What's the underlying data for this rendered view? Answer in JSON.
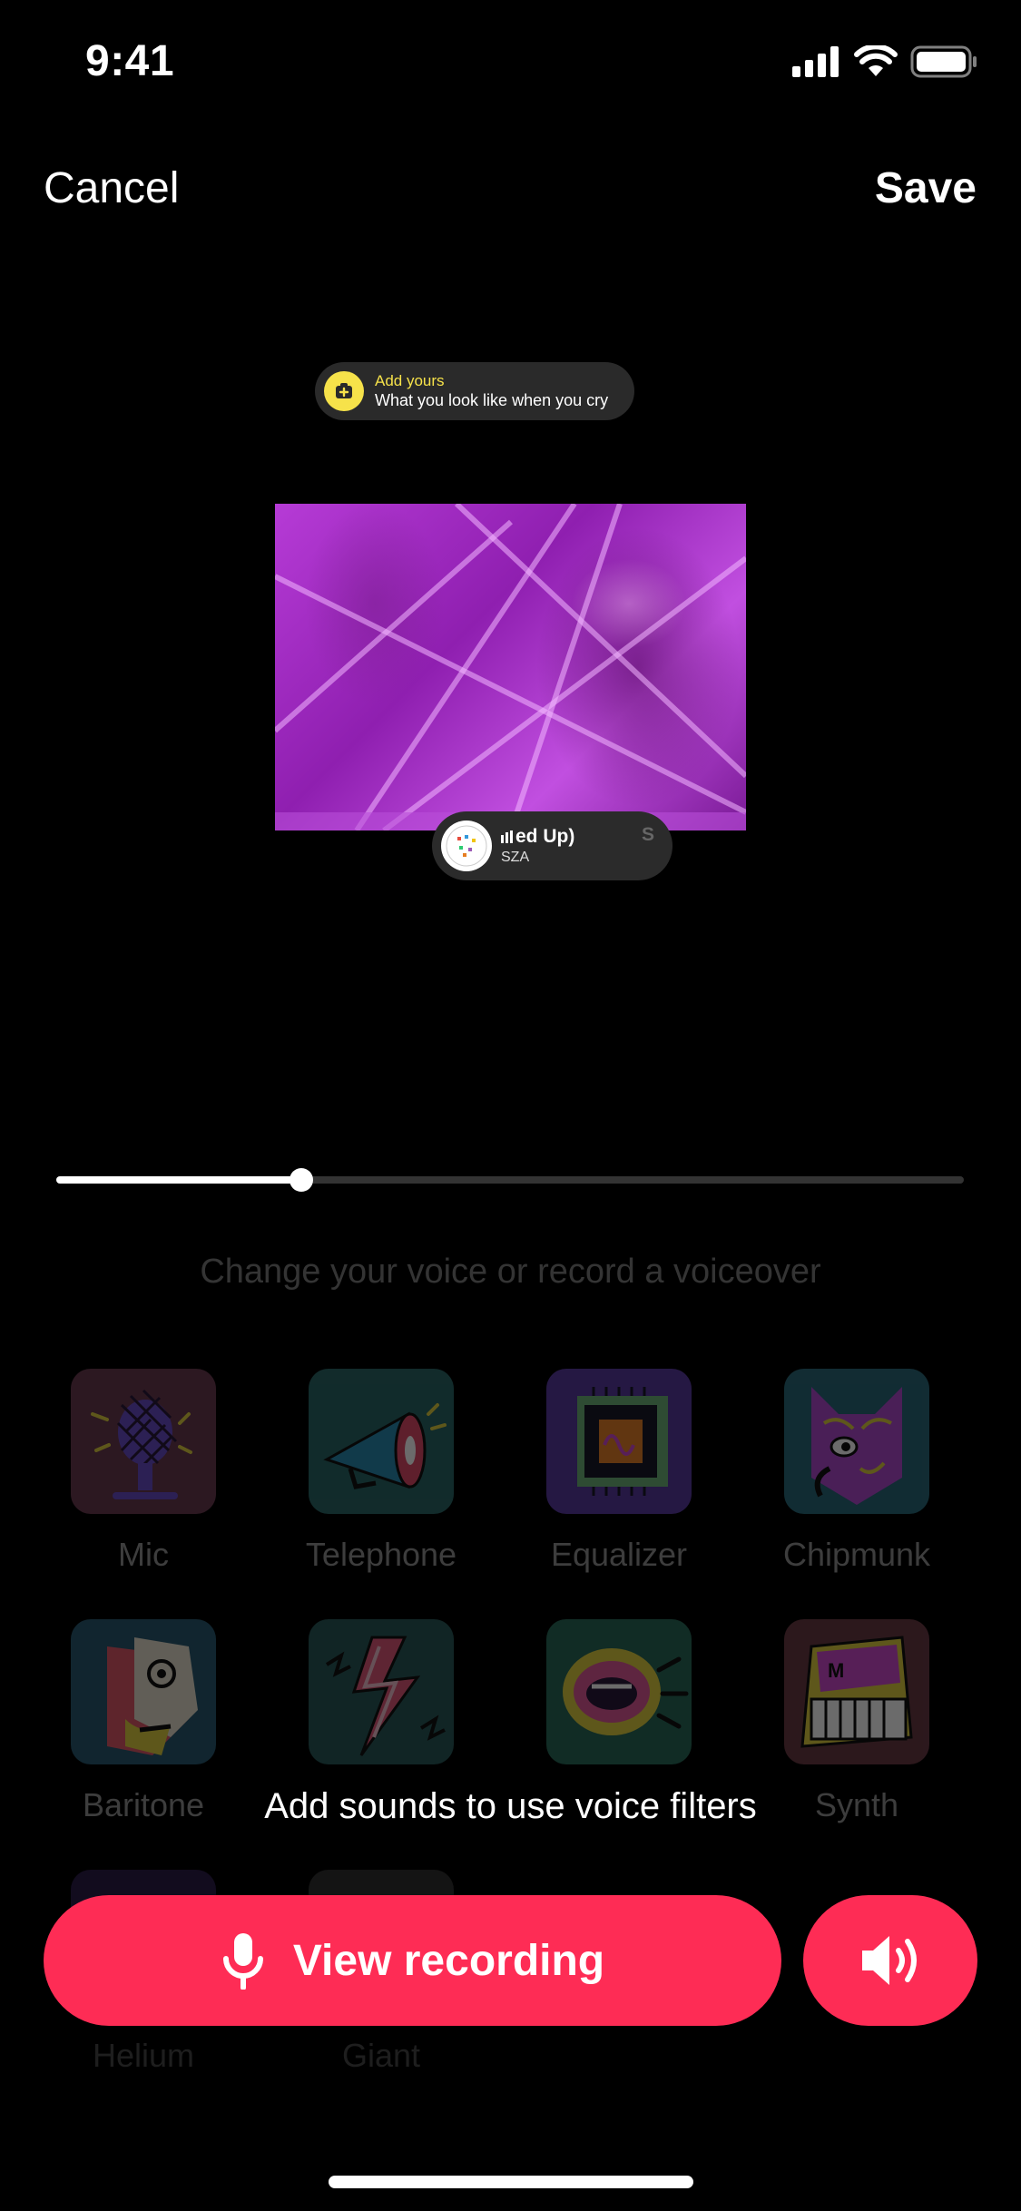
{
  "status_bar": {
    "time": "9:41"
  },
  "top_bar": {
    "cancel_label": "Cancel",
    "save_label": "Save"
  },
  "add_yours": {
    "title": "Add yours",
    "prompt": "What you look like when you cry"
  },
  "music": {
    "title": "ed Up)",
    "artist": "SZA",
    "ghost_text": "S"
  },
  "playback": {
    "progress": 0.27
  },
  "voice_hint": "Change your voice or record a voiceover",
  "filters": [
    {
      "label": "Mic",
      "icon": "mic-icon",
      "bg": "#4a2a36"
    },
    {
      "label": "Telephone",
      "icon": "megaphone-icon",
      "bg": "#1f4444"
    },
    {
      "label": "Equalizer",
      "icon": "chip-icon",
      "bg": "#3d2a6a"
    },
    {
      "label": "Chipmunk",
      "icon": "chipmunk-icon",
      "bg": "#243f4a"
    },
    {
      "label": "Baritone",
      "icon": "baritone-face-icon",
      "bg": "#1f3a48"
    },
    {
      "label": "",
      "icon": "lightning-icon",
      "bg": "#1f3a3a"
    },
    {
      "label": "",
      "icon": "lips-icon",
      "bg": "#243a3a"
    },
    {
      "label": "Synth",
      "icon": "synth-icon",
      "bg": "#3a2428"
    },
    {
      "label": "Helium",
      "icon": "helium-icon",
      "bg": "#241a3a"
    },
    {
      "label": "Giant",
      "icon": "giant-icon",
      "bg": "#242424"
    }
  ],
  "overlay_message": "Add sounds to use voice filters",
  "record_button": {
    "label": "View recording"
  },
  "colors": {
    "accent": "#fe2c55",
    "sticker_yellow": "#f6e24a"
  }
}
